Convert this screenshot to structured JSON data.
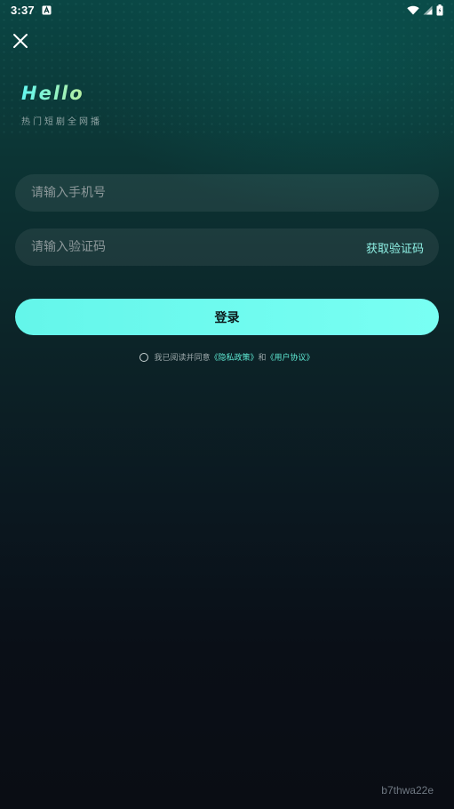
{
  "status_bar": {
    "time": "3:37",
    "app_icon": "a-letter-icon",
    "icons": [
      "wifi-icon",
      "signal-icon",
      "battery-icon"
    ]
  },
  "header": {
    "close_icon": "close-icon",
    "title": "Hello",
    "subtitle": "热门短剧全网播"
  },
  "form": {
    "phone_placeholder": "请输入手机号",
    "code_placeholder": "请输入验证码",
    "get_code_label": "获取验证码",
    "login_label": "登录"
  },
  "agreement": {
    "prefix": "我已阅读并同意",
    "privacy_link": "《隐私政策》",
    "conjunction": "和",
    "terms_link": "《用户协议》",
    "checked": false
  },
  "watermark": "b7thwa22e",
  "colors": {
    "accent": "#6ff5e2",
    "button": "#6ff6ea",
    "background_top": "#0a4644",
    "background_bottom": "#0a0d14"
  }
}
